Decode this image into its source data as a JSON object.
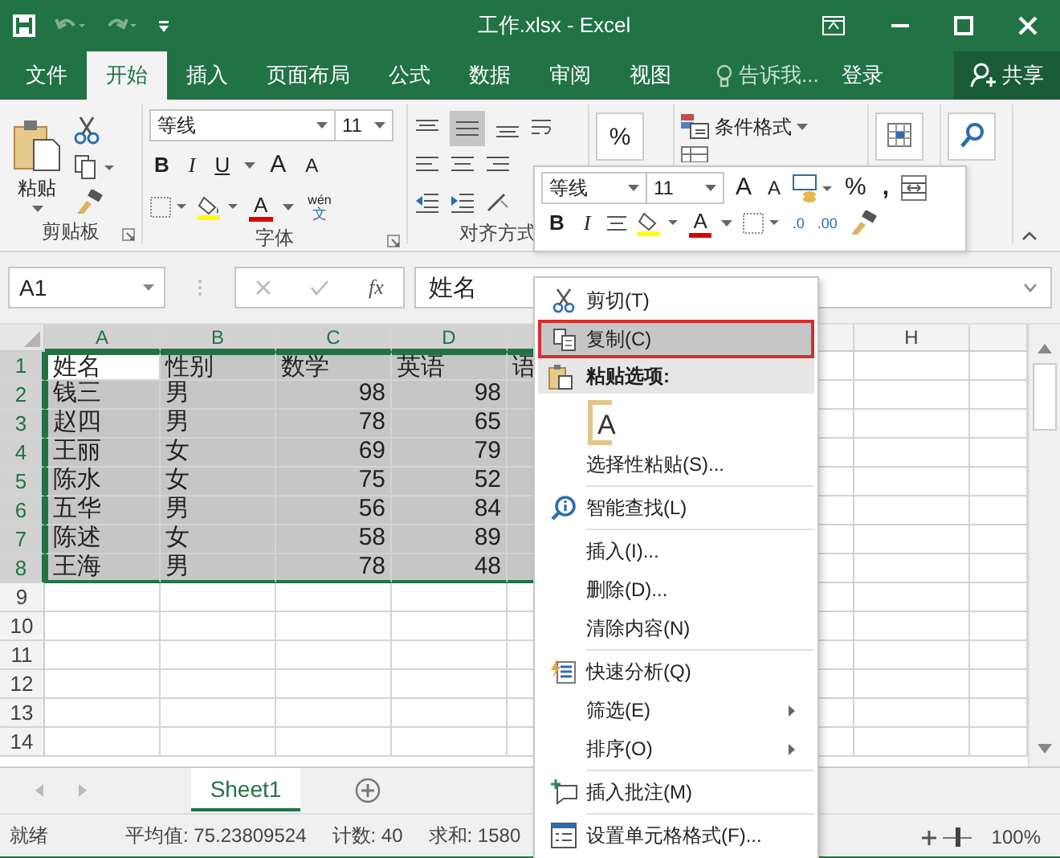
{
  "window": {
    "title": "工作.xlsx - Excel"
  },
  "tabs": [
    {
      "label": "文件",
      "selected": false
    },
    {
      "label": "开始",
      "selected": true
    },
    {
      "label": "插入",
      "selected": false
    },
    {
      "label": "页面布局",
      "selected": false
    },
    {
      "label": "公式",
      "selected": false
    },
    {
      "label": "数据",
      "selected": false
    },
    {
      "label": "审阅",
      "selected": false
    },
    {
      "label": "视图",
      "selected": false
    }
  ],
  "tell_me": "告诉我...",
  "sign_in": "登录",
  "share": "共享",
  "ribbon": {
    "clipboard": {
      "paste": "粘贴",
      "group_label": "剪贴板"
    },
    "font": {
      "font_name": "等线",
      "font_size": "11",
      "bold": "B",
      "italic": "I",
      "underline": "U",
      "grow": "A",
      "shrink": "A",
      "font_color": "A",
      "phonetic_top": "wén",
      "phonetic_bottom": "文",
      "group_label": "字体"
    },
    "alignment": {
      "group_label": "对齐方式"
    },
    "number": {
      "percent": "%"
    },
    "styles": {
      "conditional_format": "条件格式"
    }
  },
  "mini_toolbar": {
    "font_name": "等线",
    "font_size": "11",
    "grow": "A",
    "shrink": "A",
    "percent": "%",
    "comma": ",",
    "bold": "B",
    "italic": "I",
    "font_color": "A",
    "increase_decimal": ".0",
    "decrease_decimal": ".00"
  },
  "formula_bar": {
    "name_box": "A1",
    "function_label": "fx",
    "value": "姓名"
  },
  "table": {
    "columns": [
      {
        "label": "A",
        "selected": true
      },
      {
        "label": "B",
        "selected": true
      },
      {
        "label": "C",
        "selected": true
      },
      {
        "label": "D",
        "selected": true
      },
      {
        "selected": true
      },
      {
        "label": "H",
        "selected": false
      }
    ],
    "rows": [
      {
        "number": "1",
        "selected": true,
        "cells": [
          "姓名",
          "性别",
          "数学",
          "英语",
          "语"
        ]
      },
      {
        "number": "2",
        "selected": true,
        "cells": [
          "钱三",
          "男",
          "98",
          "98"
        ]
      },
      {
        "number": "3",
        "selected": true,
        "cells": [
          "赵四",
          "男",
          "78",
          "65"
        ]
      },
      {
        "number": "4",
        "selected": true,
        "cells": [
          "王丽",
          "女",
          "69",
          "79"
        ]
      },
      {
        "number": "5",
        "selected": true,
        "cells": [
          "陈水",
          "女",
          "75",
          "52"
        ]
      },
      {
        "number": "6",
        "selected": true,
        "cells": [
          "五华",
          "男",
          "56",
          "84"
        ]
      },
      {
        "number": "7",
        "selected": true,
        "cells": [
          "陈述",
          "女",
          "58",
          "89"
        ]
      },
      {
        "number": "8",
        "selected": true,
        "cells": [
          "王海",
          "男",
          "78",
          "48"
        ]
      },
      {
        "number": "9",
        "selected": false,
        "cells": []
      },
      {
        "number": "10",
        "selected": false,
        "cells": []
      },
      {
        "number": "11",
        "selected": false,
        "cells": []
      },
      {
        "number": "12",
        "selected": false,
        "cells": []
      },
      {
        "number": "13",
        "selected": false,
        "cells": []
      },
      {
        "number": "14",
        "selected": false,
        "cells": []
      }
    ]
  },
  "context_menu": [
    {
      "kind": "command",
      "label": "剪切(T)",
      "selected": false,
      "submenu": false
    },
    {
      "kind": "command",
      "label": "复制(C)",
      "selected": true,
      "submenu": false
    },
    {
      "kind": "header",
      "label": "粘贴选项:"
    },
    {
      "kind": "paste-options",
      "glyph": "A"
    },
    {
      "kind": "command",
      "label": "选择性粘贴(S)...",
      "selected": false,
      "submenu": false
    },
    {
      "kind": "separator"
    },
    {
      "kind": "command",
      "label": "智能查找(L)",
      "selected": false,
      "submenu": false
    },
    {
      "kind": "separator"
    },
    {
      "kind": "command",
      "label": "插入(I)...",
      "selected": false,
      "submenu": false
    },
    {
      "kind": "command",
      "label": "删除(D)...",
      "selected": false,
      "submenu": false
    },
    {
      "kind": "command",
      "label": "清除内容(N)",
      "selected": false,
      "submenu": false
    },
    {
      "kind": "separator"
    },
    {
      "kind": "command",
      "label": "快速分析(Q)",
      "selected": false,
      "submenu": false
    },
    {
      "kind": "command",
      "label": "筛选(E)",
      "selected": false,
      "submenu": true
    },
    {
      "kind": "command",
      "label": "排序(O)",
      "selected": false,
      "submenu": true
    },
    {
      "kind": "separator"
    },
    {
      "kind": "command",
      "label": "插入批注(M)",
      "selected": false,
      "submenu": false
    },
    {
      "kind": "separator"
    },
    {
      "kind": "command",
      "label": "设置单元格格式(F)...",
      "selected": false,
      "submenu": false
    }
  ],
  "sheet_tabs": [
    {
      "label": "Sheet1",
      "selected": true
    }
  ],
  "status_bar": {
    "ready": "就绪",
    "stats": [
      "平均值: 75.23809524",
      "计数: 40",
      "求和: 1580"
    ],
    "zoom": {
      "level": 0.5,
      "label": "100%"
    }
  }
}
